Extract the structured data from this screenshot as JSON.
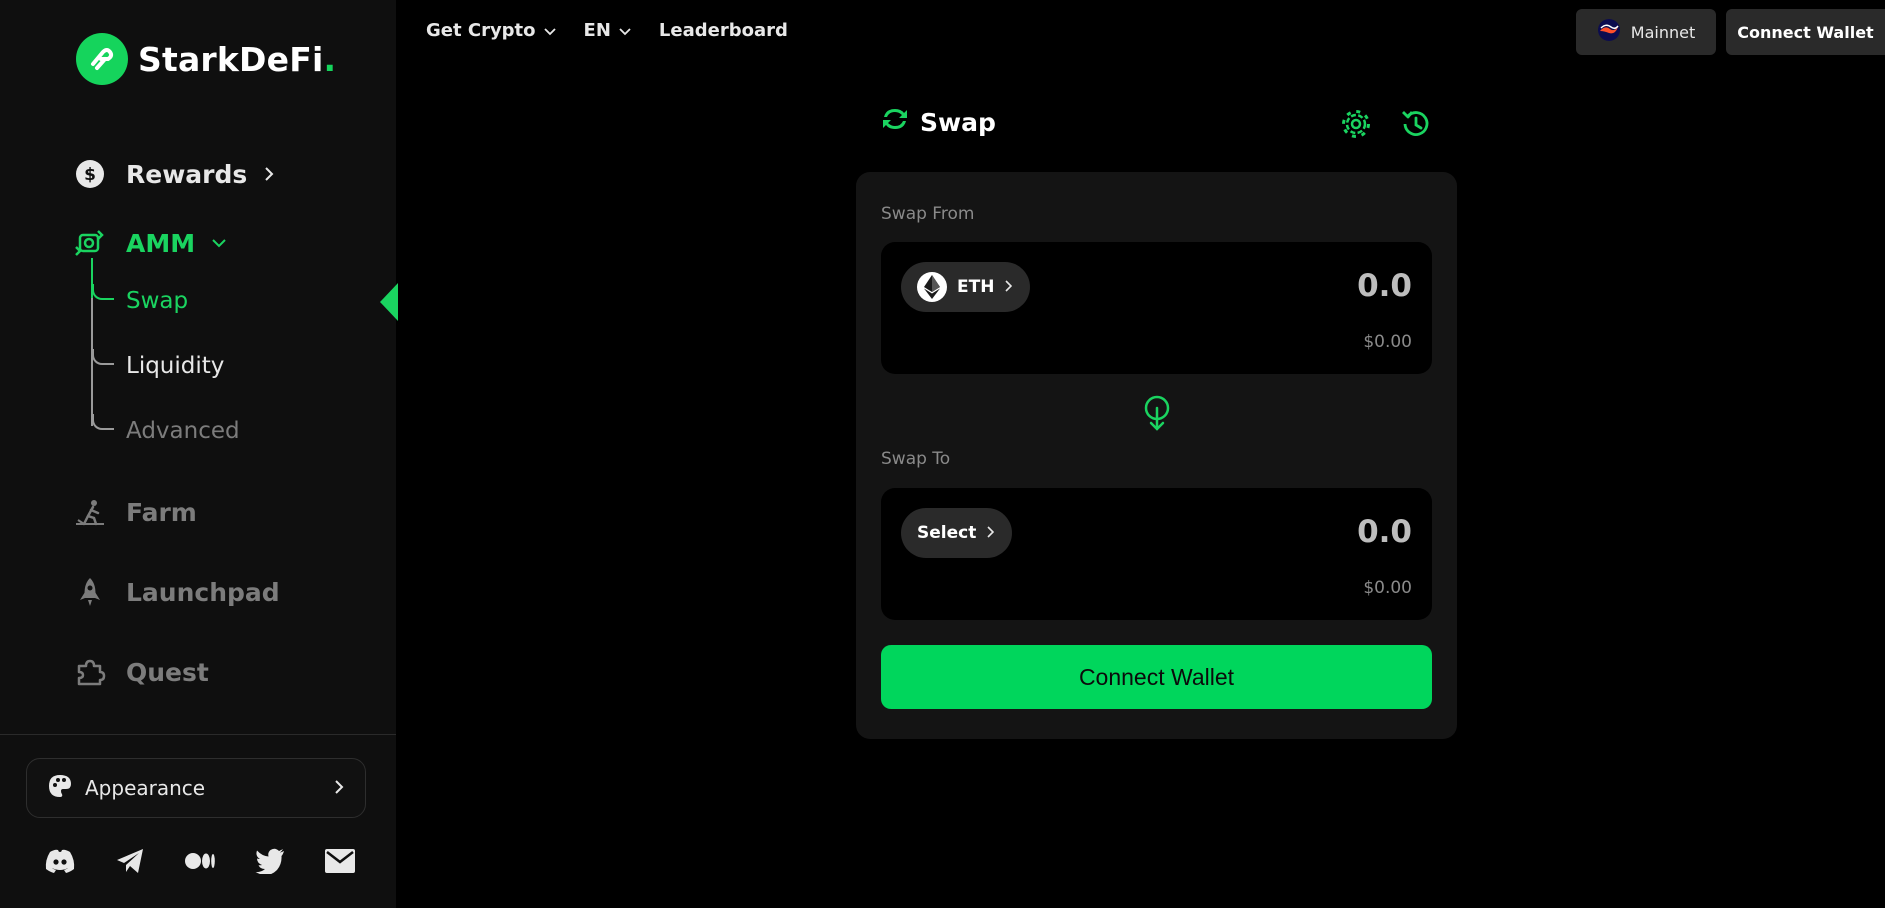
{
  "brand": {
    "name": "StarkDeFi",
    "dot": ".",
    "accent": "#15d45c"
  },
  "sidebar": {
    "rewards": "Rewards",
    "amm": "AMM",
    "amm_sub": {
      "swap": "Swap",
      "liquidity": "Liquidity",
      "advanced": "Advanced"
    },
    "farm": "Farm",
    "launchpad": "Launchpad",
    "quest": "Quest",
    "appearance": "Appearance"
  },
  "topbar": {
    "get_crypto": "Get Crypto",
    "language": "EN",
    "leaderboard": "Leaderboard",
    "network": "Mainnet",
    "connect_wallet": "Connect Wallet"
  },
  "swap": {
    "title": "Swap",
    "from_label": "Swap From",
    "from_token": "ETH",
    "from_amount": "0.0",
    "from_usd": "$0.00",
    "to_label": "Swap To",
    "to_token": "Select",
    "to_amount": "0.0",
    "to_usd": "$0.00",
    "connect_button": "Connect Wallet"
  }
}
